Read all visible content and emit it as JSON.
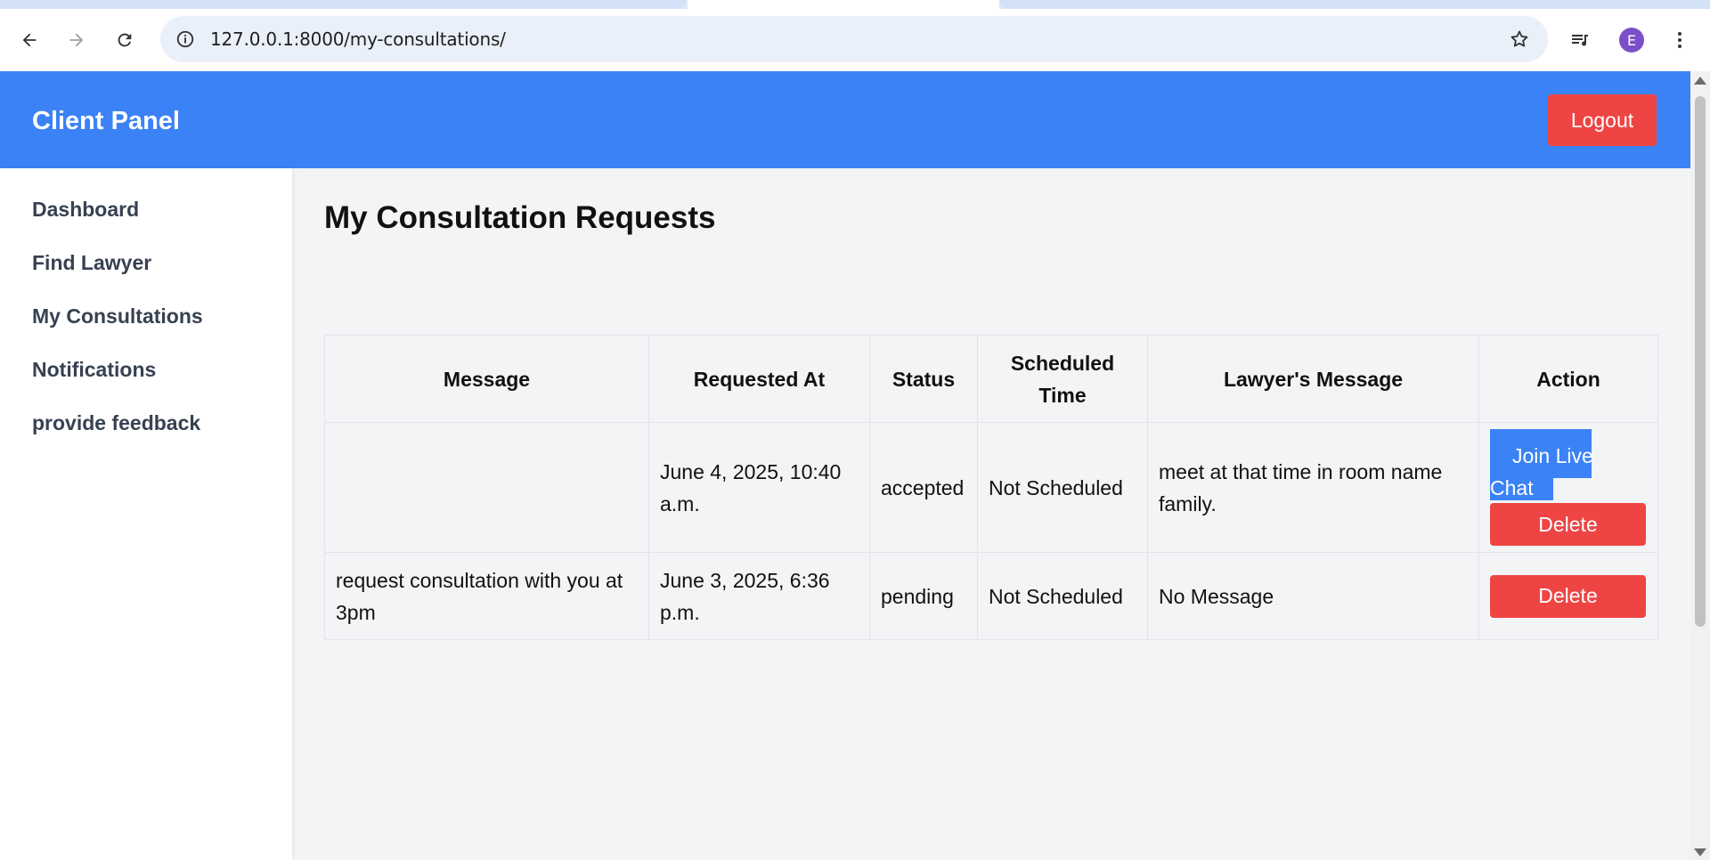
{
  "browser": {
    "url": "127.0.0.1:8000/my-consultations/",
    "profile_initial": "E"
  },
  "header": {
    "brand": "Client Panel",
    "logout_label": "Logout"
  },
  "sidebar": {
    "items": [
      {
        "label": "Dashboard"
      },
      {
        "label": "Find Lawyer"
      },
      {
        "label": "My Consultations"
      },
      {
        "label": "Notifications"
      },
      {
        "label": "provide feedback"
      }
    ]
  },
  "main": {
    "title": "My Consultation Requests",
    "table": {
      "headers": [
        "Message",
        "Requested At",
        "Status",
        "Scheduled Time",
        "Lawyer's Message",
        "Action"
      ],
      "rows": [
        {
          "message": "",
          "requested_at": "June 4, 2025, 10:40 a.m.",
          "status": "accepted",
          "scheduled_time": "Not Scheduled",
          "lawyer_message": "meet at that time in room name family.",
          "join_label_1": "Join Live",
          "join_label_2": "Chat",
          "delete_label": "Delete"
        },
        {
          "message": "request consultation with you at 3pm",
          "requested_at": "June 3, 2025, 6:36 p.m.",
          "status": "pending",
          "scheduled_time": "Not Scheduled",
          "lawyer_message": "No Message",
          "delete_label": "Delete"
        }
      ]
    }
  },
  "colors": {
    "header": "#3b82f6",
    "danger": "#ef4444",
    "accepted": "#22c55e",
    "pending": "#eab308"
  }
}
